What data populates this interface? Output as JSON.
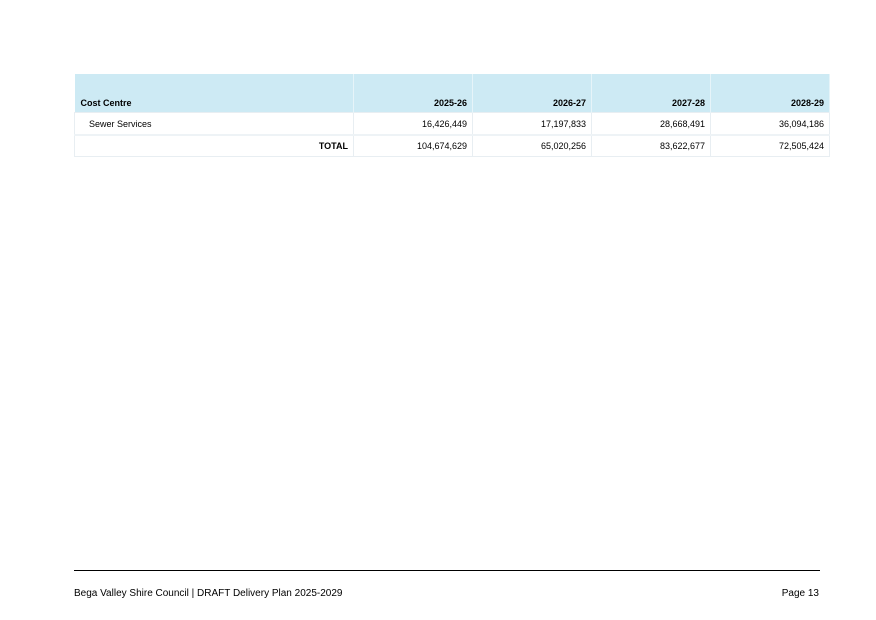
{
  "table": {
    "headers": {
      "cost_centre": "Cost Centre",
      "years": [
        "2025-26",
        "2026-27",
        "2027-28",
        "2028-29"
      ]
    },
    "rows": [
      {
        "name": "Sewer Services",
        "values": [
          "16,426,449",
          "17,197,833",
          "28,668,491",
          "36,094,186"
        ]
      }
    ],
    "total": {
      "label": "TOTAL",
      "values": [
        "104,674,629",
        "65,020,256",
        "83,622,677",
        "72,505,424"
      ]
    },
    "header_color": "#cdeaf4"
  },
  "footer": {
    "left": "Bega Valley Shire Council | DRAFT Delivery Plan 2025-2029",
    "right": "Page 13"
  }
}
